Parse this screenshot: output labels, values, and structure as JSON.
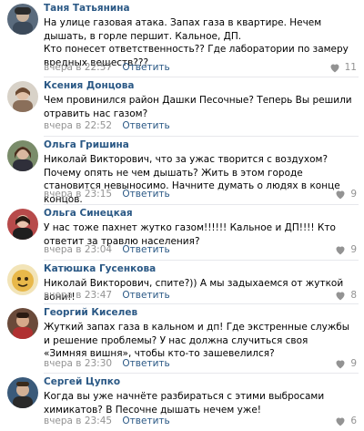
{
  "comments": [
    {
      "author": "Таня Татьянина",
      "text": "На улице газовая атака. Запах газа в квартире. Нечем дышать, в горле першит. Кальное, ДП.\nКто понесет ответственность?? Где лаборатории по замеру вредных веществ???",
      "time": "вчера в 22:57",
      "reply": "Ответить",
      "likes": "11"
    },
    {
      "author": "Ксения Донцова",
      "text": "Чем провинился район Дашки Песочные? Теперь Вы решили отравить нас газом?",
      "time": "вчера в 22:52",
      "reply": "Ответить",
      "likes": ""
    },
    {
      "author": "Ольга Гришина",
      "text": "Николай Викторович, что за ужас творится с воздухом? Почему опять не чем дышать? Жить в этом городе становится невыносимо. Начните думать о людях в конце концов.",
      "time": "вчера в 23:15",
      "reply": "Ответить",
      "likes": "9"
    },
    {
      "author": "Ольга Синецкая",
      "text": "У нас тоже пахнет жутко газом!!!!!! Кальное и ДП!!!! Кто ответит за травлю населения?",
      "time": "вчера в 23:04",
      "reply": "Ответить",
      "likes": "9"
    },
    {
      "author": "Катюшка Гусенкова",
      "text": "Николай Викторович, спите?)) А мы задыхаемся от жуткой вони!!",
      "time": "вчера в 23:47",
      "reply": "Ответить",
      "likes": "8"
    },
    {
      "author": "Георгий Киселев",
      "text": "Жуткий запах газа в кальном и дп! Где экстренные службы и решение проблемы? У нас должна случиться своя «Зимняя вишня», чтобы кто-то зашевелился?",
      "time": "вчера в 23:30",
      "reply": "Ответить",
      "likes": "9"
    },
    {
      "author": "Сергей Цупко",
      "text": "Когда вы уже начнёте разбираться с этими выбросами химикатов? В Песочне дышать нечем уже!",
      "time": "вчера в 23:45",
      "reply": "Ответить",
      "likes": "6"
    }
  ],
  "colors": {
    "author": "#2a5885",
    "meta": "#939393",
    "separator": "#e7e8ec"
  },
  "icons": {
    "like": "heart-icon",
    "avatar": "user-avatar"
  }
}
